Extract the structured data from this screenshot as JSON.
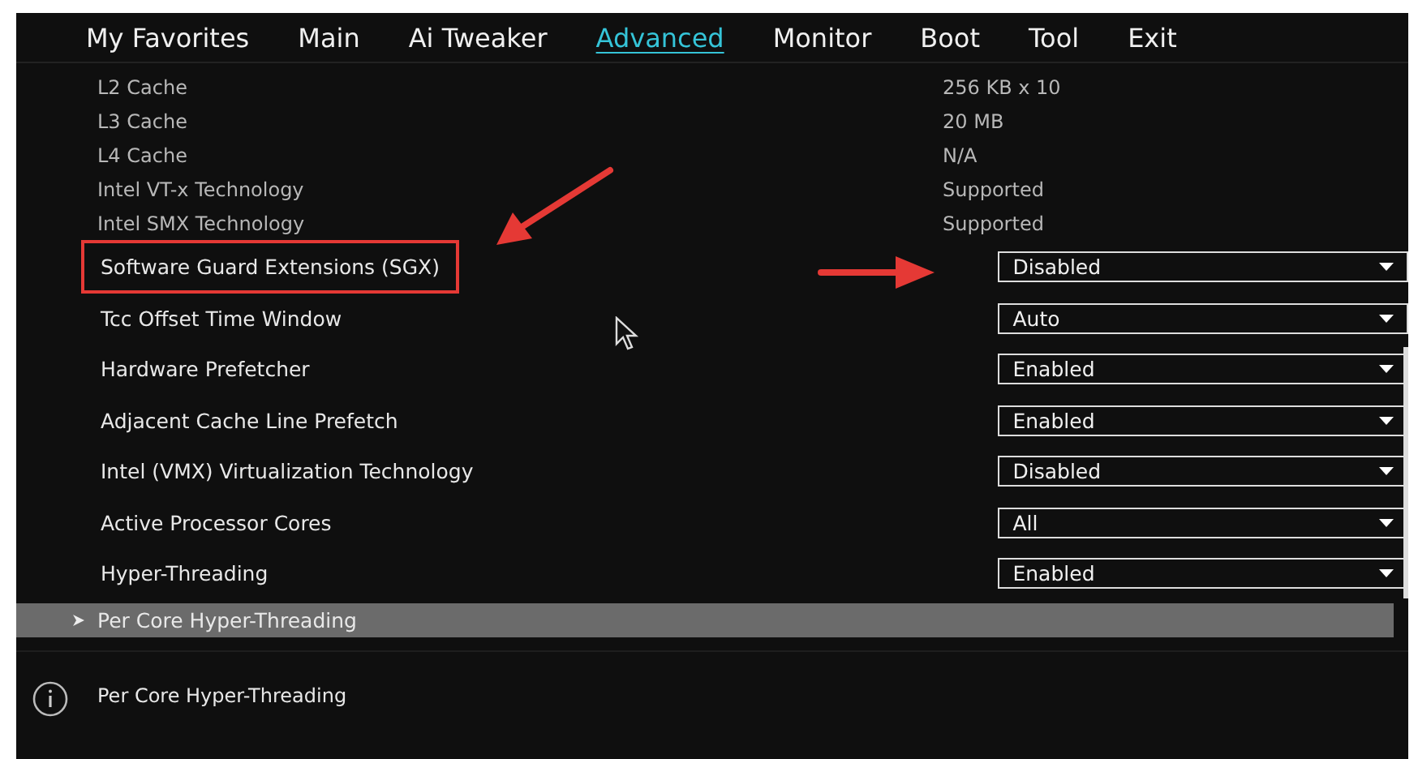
{
  "tabs": [
    {
      "label": "My Favorites",
      "selected": false
    },
    {
      "label": "Main",
      "selected": false
    },
    {
      "label": "Ai Tweaker",
      "selected": false
    },
    {
      "label": "Advanced",
      "selected": true
    },
    {
      "label": "Monitor",
      "selected": false
    },
    {
      "label": "Boot",
      "selected": false
    },
    {
      "label": "Tool",
      "selected": false
    },
    {
      "label": "Exit",
      "selected": false
    }
  ],
  "info_rows": [
    {
      "label": "L2 Cache",
      "value": "256 KB x 10"
    },
    {
      "label": "L3 Cache",
      "value": "20 MB"
    },
    {
      "label": "L4 Cache",
      "value": "N/A"
    },
    {
      "label": "Intel VT-x Technology",
      "value": "Supported"
    },
    {
      "label": "Intel SMX Technology",
      "value": "Supported"
    }
  ],
  "settings": [
    {
      "label": "Software Guard Extensions (SGX)",
      "value": "Disabled",
      "highlighted": true
    },
    {
      "label": "Tcc Offset Time Window",
      "value": "Auto",
      "highlighted": false
    },
    {
      "label": "Hardware Prefetcher",
      "value": "Enabled",
      "highlighted": false
    },
    {
      "label": "Adjacent Cache Line Prefetch",
      "value": "Enabled",
      "highlighted": false
    },
    {
      "label": "Intel (VMX) Virtualization Technology",
      "value": "Disabled",
      "highlighted": false
    },
    {
      "label": "Active Processor Cores",
      "value": "All",
      "highlighted": false
    },
    {
      "label": "Hyper-Threading",
      "value": "Enabled",
      "highlighted": false
    }
  ],
  "submenu": {
    "label": "Per Core Hyper-Threading",
    "selected": true
  },
  "help": {
    "text": "Per Core Hyper-Threading"
  }
}
